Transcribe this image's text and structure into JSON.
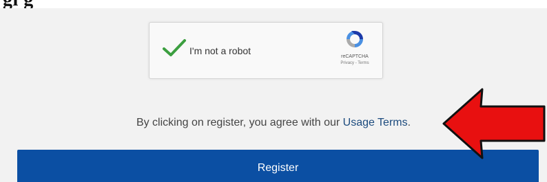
{
  "header": {
    "partial_heading": "gi                    g"
  },
  "captcha": {
    "label": "I'm not a robot",
    "brand": "reCAPTCHA",
    "privacy_link": "Privacy",
    "separator": " - ",
    "terms_link": "Terms",
    "checked": true,
    "check_color": "#3c9f40"
  },
  "agreement": {
    "text_prefix": "By clicking on register, you agree with our ",
    "link_label": "Usage Terms",
    "text_suffix": "."
  },
  "register": {
    "label": "Register",
    "color": "#0b4fa3"
  },
  "annotation": {
    "arrow_color": "#e81010"
  }
}
